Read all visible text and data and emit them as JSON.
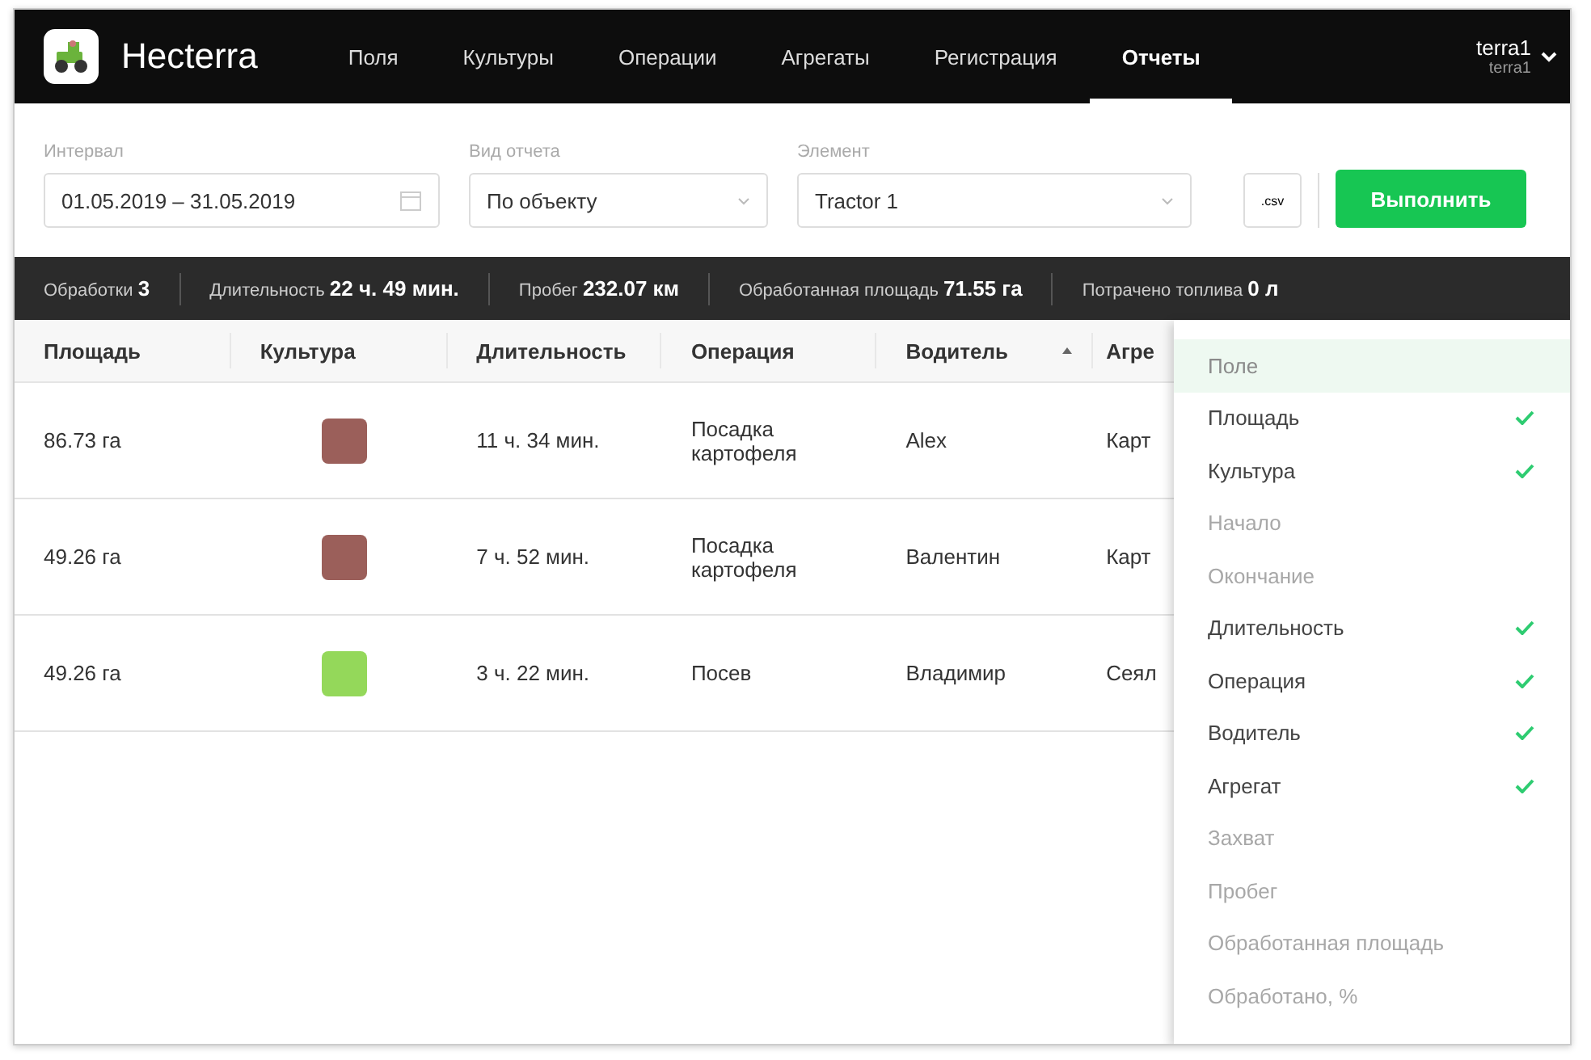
{
  "header": {
    "brand": "Hecterra",
    "nav": [
      {
        "label": "Поля",
        "selected": false
      },
      {
        "label": "Культуры",
        "selected": false
      },
      {
        "label": "Операции",
        "selected": false
      },
      {
        "label": "Агрегаты",
        "selected": false
      },
      {
        "label": "Регистрация",
        "selected": false
      },
      {
        "label": "Отчеты",
        "selected": true
      }
    ],
    "user": {
      "name": "terra1",
      "login": "terra1"
    }
  },
  "filters": {
    "interval": {
      "label": "Интервал",
      "value": "01.05.2019 – 31.05.2019"
    },
    "report_type": {
      "label": "Вид отчета",
      "value": "По объекту"
    },
    "element": {
      "label": "Элемент",
      "value": "Tractor 1"
    },
    "csv_button": ".csv",
    "run_button": "Выполнить"
  },
  "stats": [
    {
      "label": "Обработки",
      "value": "3"
    },
    {
      "label": "Длительность",
      "value": "22 ч. 49 мин."
    },
    {
      "label": "Пробег",
      "value": "232.07 км"
    },
    {
      "label": "Обработанная площадь",
      "value": "71.55 га"
    },
    {
      "label": "Потрачено топлива",
      "value": "0 л"
    }
  ],
  "table": {
    "columns": [
      "Площадь",
      "Культура",
      "Длительность",
      "Операция",
      "Водитель",
      "Агре"
    ],
    "rows": [
      {
        "area": "86.73 га",
        "color": "#9b5f5a",
        "duration": "11 ч. 34 мин.",
        "operation": "Посадка картофеля",
        "driver": "Alex",
        "column_6": "Карт"
      },
      {
        "area": "49.26 га",
        "color": "#9b5f5a",
        "duration": "7 ч. 52 мин.",
        "operation": "Посадка картофеля",
        "driver": "Валентин",
        "column_6": "Карт"
      },
      {
        "area": "49.26 га",
        "color": "#94d85a",
        "duration": "3 ч. 22 мин.",
        "operation": "Посев",
        "driver": "Владимир",
        "column_6": "Сеял"
      }
    ]
  },
  "column_menu": [
    {
      "label": "Поле",
      "checked": false,
      "selected": true
    },
    {
      "label": "Площадь",
      "checked": true,
      "selected": false
    },
    {
      "label": "Культура",
      "checked": true,
      "selected": false
    },
    {
      "label": "Начало",
      "checked": false,
      "selected": false
    },
    {
      "label": "Окончание",
      "checked": false,
      "selected": false
    },
    {
      "label": "Длительность",
      "checked": true,
      "selected": false
    },
    {
      "label": "Операция",
      "checked": true,
      "selected": false
    },
    {
      "label": "Водитель",
      "checked": true,
      "selected": false
    },
    {
      "label": "Агрегат",
      "checked": true,
      "selected": false
    },
    {
      "label": "Захват",
      "checked": false,
      "selected": false
    },
    {
      "label": "Пробег",
      "checked": false,
      "selected": false
    },
    {
      "label": "Обработанная площадь",
      "checked": false,
      "selected": false
    },
    {
      "label": "Обработано, %",
      "checked": false,
      "selected": false
    }
  ]
}
